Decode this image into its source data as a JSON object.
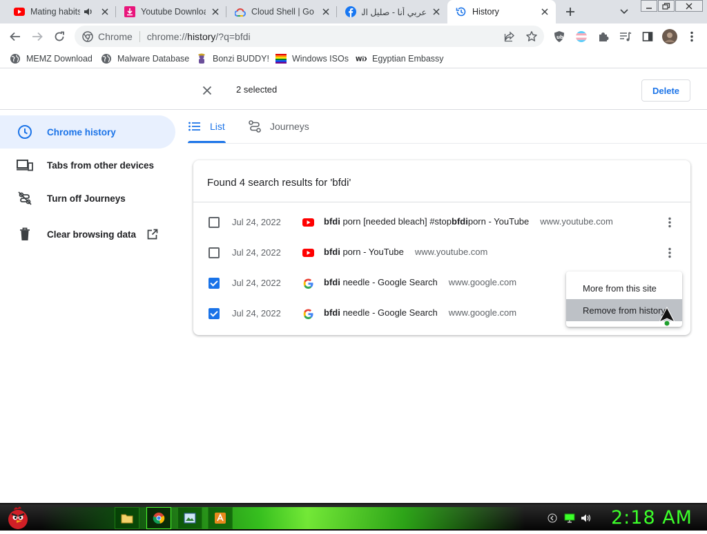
{
  "tabs": [
    {
      "title": "Mating habits",
      "icon": "youtube-icon"
    },
    {
      "title": "Youtube Download",
      "icon": "download-icon"
    },
    {
      "title": "Cloud Shell | Go",
      "icon": "google-cloud-icon"
    },
    {
      "title": "عربي أنا - صليل الصو",
      "icon": "facebook-icon"
    },
    {
      "title": "History",
      "icon": "history-icon"
    }
  ],
  "omnibox": {
    "label": "Chrome",
    "url_prefix": "chrome://",
    "url_host": "history",
    "url_rest": "/?q=bfdi"
  },
  "bookmarks": [
    {
      "label": "MEMZ Download",
      "icon": "globe-icon"
    },
    {
      "label": "Malware Database",
      "icon": "globe-icon"
    },
    {
      "label": "Bonzi BUDDY!",
      "icon": "bonzi-icon"
    },
    {
      "label": "Windows ISOs",
      "icon": "rainbow-flag-icon"
    },
    {
      "label": "Egyptian Embassy",
      "icon": "wix-icon"
    }
  ],
  "selection": {
    "count_text": "2 selected",
    "delete_label": "Delete"
  },
  "sidebar": [
    {
      "label": "Chrome history",
      "icon": "clock-icon",
      "active": true
    },
    {
      "label": "Tabs from other devices",
      "icon": "devices-icon"
    },
    {
      "label": "Turn off Journeys",
      "icon": "journeys-off-icon"
    },
    {
      "label": "Clear browsing data",
      "icon": "trash-icon"
    }
  ],
  "history_tabs": [
    {
      "label": "List",
      "icon": "list-icon",
      "active": true
    },
    {
      "label": "Journeys",
      "icon": "journeys-icon"
    }
  ],
  "results": {
    "heading": "Found 4 search results for 'bfdi'",
    "rows": [
      {
        "date": "Jul 24, 2022",
        "favicon": "youtube-icon",
        "title_parts": [
          "bfdi",
          " porn [needed bleach] #stop",
          "bfdi",
          "porn - YouTube"
        ],
        "domain": "www.youtube.com",
        "checked": false
      },
      {
        "date": "Jul 24, 2022",
        "favicon": "youtube-icon",
        "title_parts": [
          "bfdi",
          " porn - YouTube"
        ],
        "domain": "www.youtube.com",
        "checked": false
      },
      {
        "date": "Jul 24, 2022",
        "favicon": "google-icon",
        "title_parts": [
          "bfdi",
          " needle - Google Search"
        ],
        "domain": "www.google.com",
        "checked": true
      },
      {
        "date": "Jul 24, 2022",
        "favicon": "google-icon",
        "title_parts": [
          "bfdi",
          " needle - Google Search"
        ],
        "domain": "www.google.com",
        "checked": true
      }
    ]
  },
  "context_menu": [
    "More from this site",
    "Remove from history"
  ],
  "taskbar": {
    "clock": "2:18 AM"
  },
  "colors": {
    "accent": "#1a73e8",
    "taskbar_green": "#3cff2a"
  }
}
